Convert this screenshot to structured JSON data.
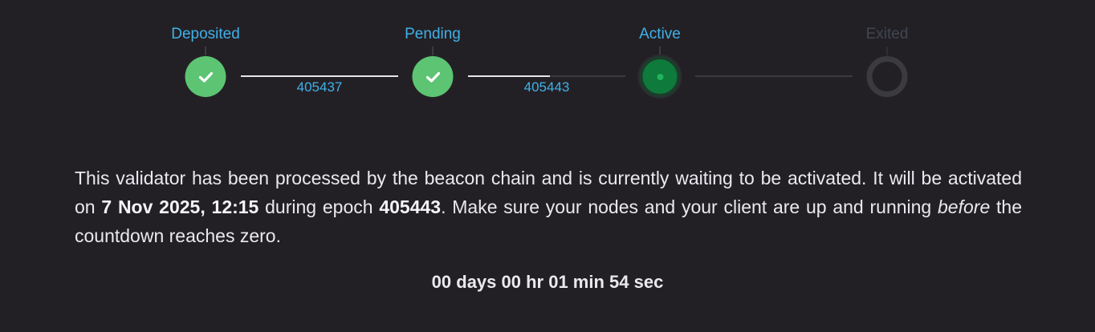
{
  "steps": [
    {
      "label": "Deposited",
      "state": "done"
    },
    {
      "label": "Pending",
      "state": "done"
    },
    {
      "label": "Active",
      "state": "active"
    },
    {
      "label": "Exited",
      "state": "future"
    }
  ],
  "connectors": [
    {
      "epoch": "405437",
      "progress": 1.0
    },
    {
      "epoch": "405443",
      "progress": 0.52
    },
    {
      "epoch": "",
      "progress": 0.0
    }
  ],
  "description": {
    "part1": "This validator has been processed by the beacon chain and is currently waiting to be activated. It will be activated on ",
    "date": "7 Nov 2025, 12:15",
    "part2": " during epoch ",
    "epoch": "405443",
    "part3": ". Make sure your nodes and your client are up and running ",
    "emphasis": "before",
    "part4": " the countdown reaches zero."
  },
  "countdown": {
    "text": "00 days 00 hr 01 min 54 sec"
  },
  "colors": {
    "background": "#232025",
    "accent_blue": "#3fb1e8",
    "done_green": "#5cc472",
    "active_green": "#0e7a3b",
    "inactive": "#3a3a3f"
  }
}
